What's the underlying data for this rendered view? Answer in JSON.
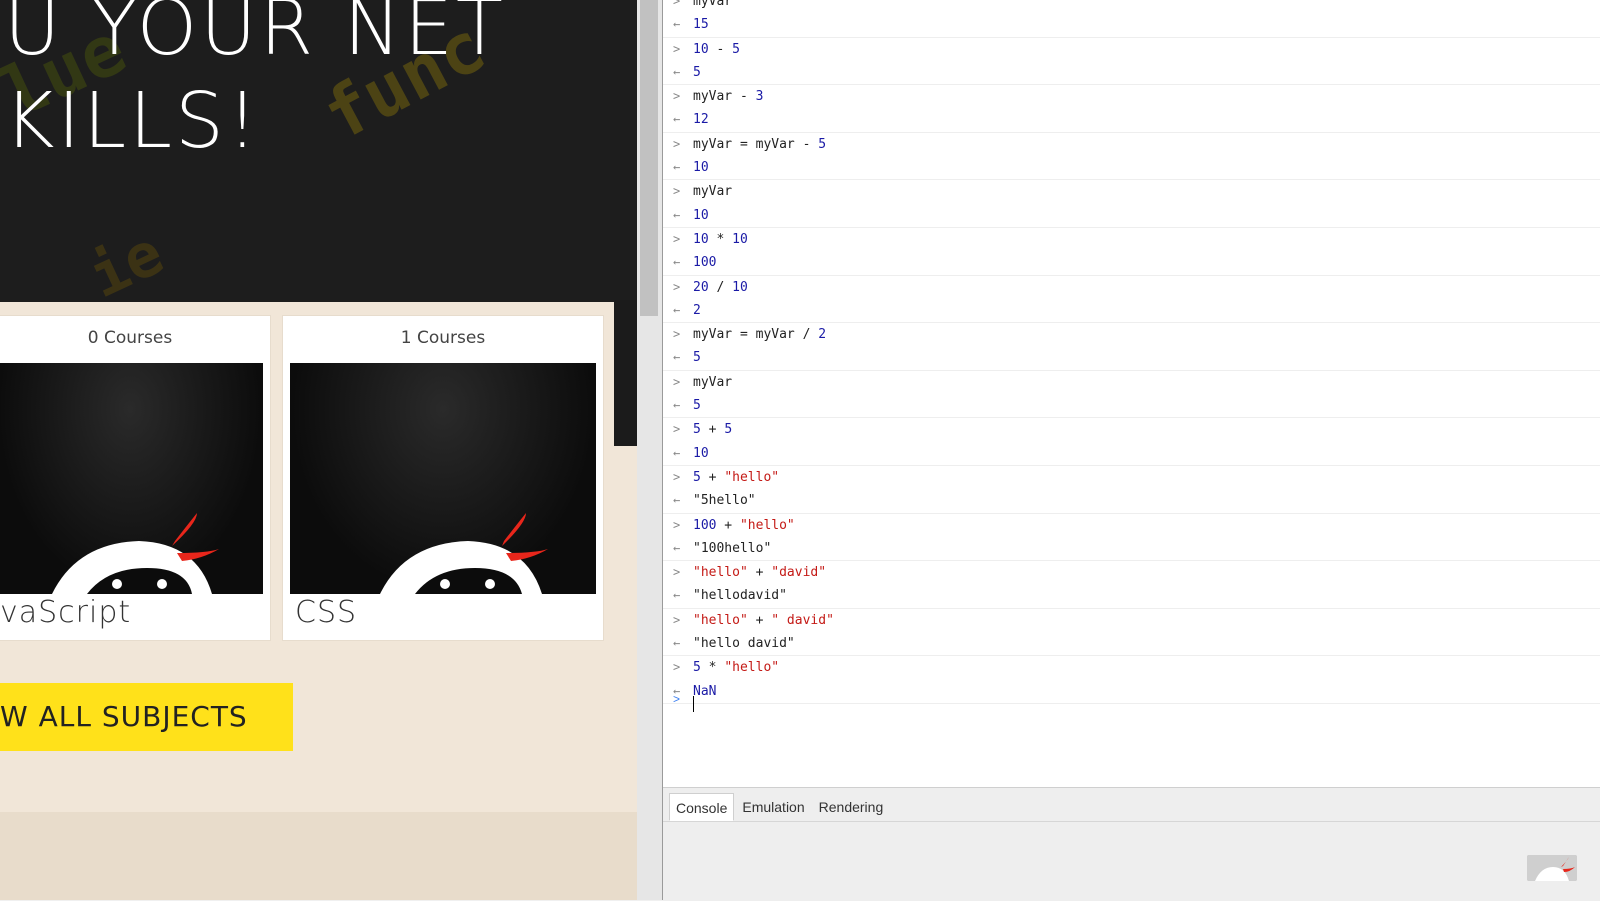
{
  "site": {
    "hero_title": "U YOUR NET\nKILLS!",
    "cards": [
      {
        "count": "0 Courses",
        "name": "vaScript"
      },
      {
        "count": "1 Courses",
        "name": "CSS"
      }
    ],
    "subjects_button": "W ALL SUBJECTS"
  },
  "console": {
    "entries": [
      {
        "input": [
          {
            "t": "myVar"
          }
        ],
        "output": "15",
        "output_type": "num"
      },
      {
        "input": [
          {
            "t": "10",
            "k": "num"
          },
          {
            "t": " - "
          },
          {
            "t": "5",
            "k": "num"
          }
        ],
        "output": "5",
        "output_type": "num"
      },
      {
        "input": [
          {
            "t": "myVar - "
          },
          {
            "t": "3",
            "k": "num"
          }
        ],
        "output": "12",
        "output_type": "num"
      },
      {
        "input": [
          {
            "t": "myVar = myVar - "
          },
          {
            "t": "5",
            "k": "num"
          }
        ],
        "output": "10",
        "output_type": "num"
      },
      {
        "input": [
          {
            "t": "myVar"
          }
        ],
        "output": "10",
        "output_type": "num"
      },
      {
        "input": [
          {
            "t": "10",
            "k": "num"
          },
          {
            "t": " * "
          },
          {
            "t": "10",
            "k": "num"
          }
        ],
        "output": "100",
        "output_type": "num"
      },
      {
        "input": [
          {
            "t": "20",
            "k": "num"
          },
          {
            "t": " / "
          },
          {
            "t": "10",
            "k": "num"
          }
        ],
        "output": "2",
        "output_type": "num"
      },
      {
        "input": [
          {
            "t": "myVar = myVar / "
          },
          {
            "t": "2",
            "k": "num"
          }
        ],
        "output": "5",
        "output_type": "num"
      },
      {
        "input": [
          {
            "t": "myVar"
          }
        ],
        "output": "5",
        "output_type": "num"
      },
      {
        "input": [
          {
            "t": "5",
            "k": "num"
          },
          {
            "t": " + "
          },
          {
            "t": "5",
            "k": "num"
          }
        ],
        "output": "10",
        "output_type": "num"
      },
      {
        "input": [
          {
            "t": "5",
            "k": "num"
          },
          {
            "t": " + "
          },
          {
            "t": "\"hello\"",
            "k": "str"
          }
        ],
        "output": "\"5hello\"",
        "output_type": "str"
      },
      {
        "input": [
          {
            "t": "100",
            "k": "num"
          },
          {
            "t": " + "
          },
          {
            "t": "\"hello\"",
            "k": "str"
          }
        ],
        "output": "\"100hello\"",
        "output_type": "str"
      },
      {
        "input": [
          {
            "t": "\"hello\"",
            "k": "str"
          },
          {
            "t": " + "
          },
          {
            "t": "\"david\"",
            "k": "str"
          }
        ],
        "output": "\"hellodavid\"",
        "output_type": "str"
      },
      {
        "input": [
          {
            "t": "\"hello\"",
            "k": "str"
          },
          {
            "t": " + "
          },
          {
            "t": "\" david\"",
            "k": "str"
          }
        ],
        "output": "\"hello david\"",
        "output_type": "str"
      },
      {
        "input": [
          {
            "t": "5",
            "k": "num"
          },
          {
            "t": " * "
          },
          {
            "t": "\"hello\"",
            "k": "str"
          }
        ],
        "output": "NaN",
        "output_type": "nan"
      }
    ]
  },
  "drawer": {
    "tabs": [
      {
        "label": "Console",
        "active": true
      },
      {
        "label": "Emulation",
        "active": false
      },
      {
        "label": "Rendering",
        "active": false
      }
    ]
  }
}
